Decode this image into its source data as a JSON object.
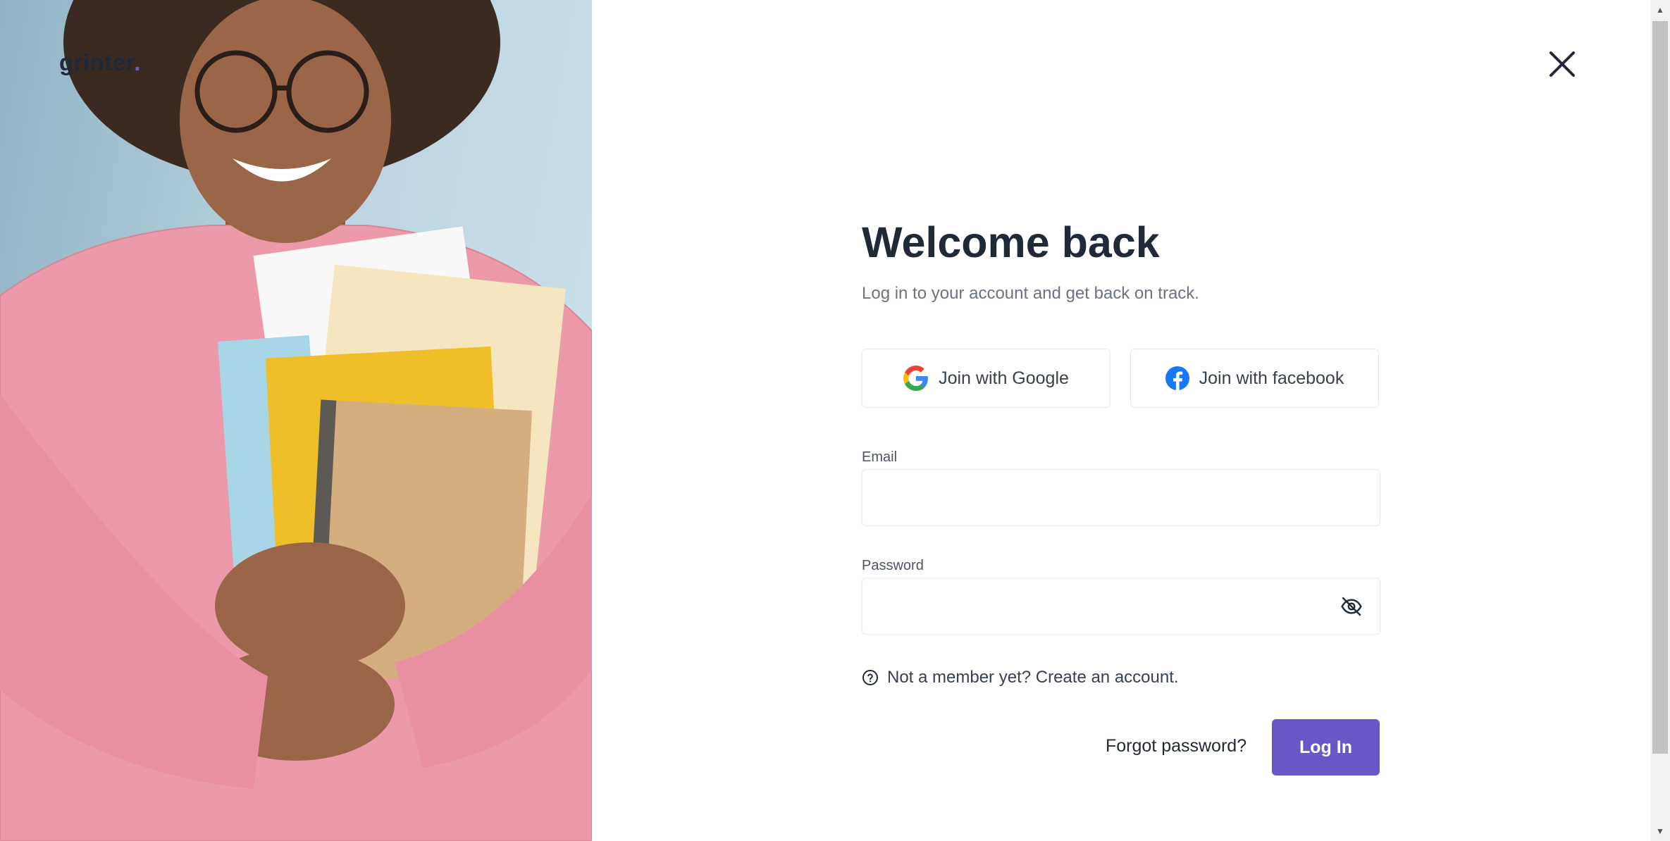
{
  "brand": {
    "logo_text": "grinter",
    "logo_dot": ".",
    "accent": "#6b56c7"
  },
  "header": {
    "close_label": "×"
  },
  "login": {
    "title": "Welcome back",
    "subtitle": "Log in to your account and get back on track.",
    "social": {
      "google_label": "Join with Google",
      "facebook_label": "Join with facebook"
    },
    "email": {
      "label": "Email",
      "value": "",
      "placeholder": ""
    },
    "password": {
      "label": "Password",
      "value": "",
      "placeholder": ""
    },
    "signup_prompt": "Not a member yet? Create an account.",
    "forgot_label": "Forgot password?",
    "submit_label": "Log In"
  },
  "icons": {
    "close": "close-icon",
    "google": "google-icon",
    "facebook": "facebook-icon",
    "eye": "eye-off-icon",
    "help": "question-circle-icon"
  }
}
